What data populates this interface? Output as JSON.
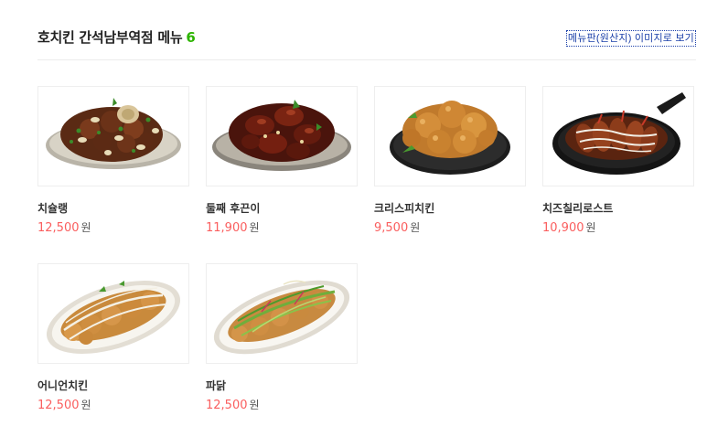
{
  "header": {
    "title": "호치킨 간석남부역점 메뉴",
    "count": "6",
    "menu_image_link": "메뉴판(원산지) 이미지로 보기"
  },
  "menu_items": [
    {
      "name": "치슐랭",
      "price": "12,500",
      "currency": "원",
      "image": "chicken-nuts-platter"
    },
    {
      "name": "둘째 후끈이",
      "price": "11,900",
      "currency": "원",
      "image": "spicy-glazed-chicken"
    },
    {
      "name": "크리스피치킨",
      "price": "9,500",
      "currency": "원",
      "image": "fried-chicken-black-plate"
    },
    {
      "name": "치즈칠리로스트",
      "price": "10,900",
      "currency": "원",
      "image": "cheese-chili-roast-skillet"
    },
    {
      "name": "어니언치킨",
      "price": "12,500",
      "currency": "원",
      "image": "onion-chicken-oval-plate"
    },
    {
      "name": "파닭",
      "price": "12,500",
      "currency": "원",
      "image": "green-onion-chicken-oval-plate"
    }
  ],
  "colors": {
    "price": "#fa5e5e",
    "count": "#2db400",
    "link": "#1a3fa8"
  }
}
